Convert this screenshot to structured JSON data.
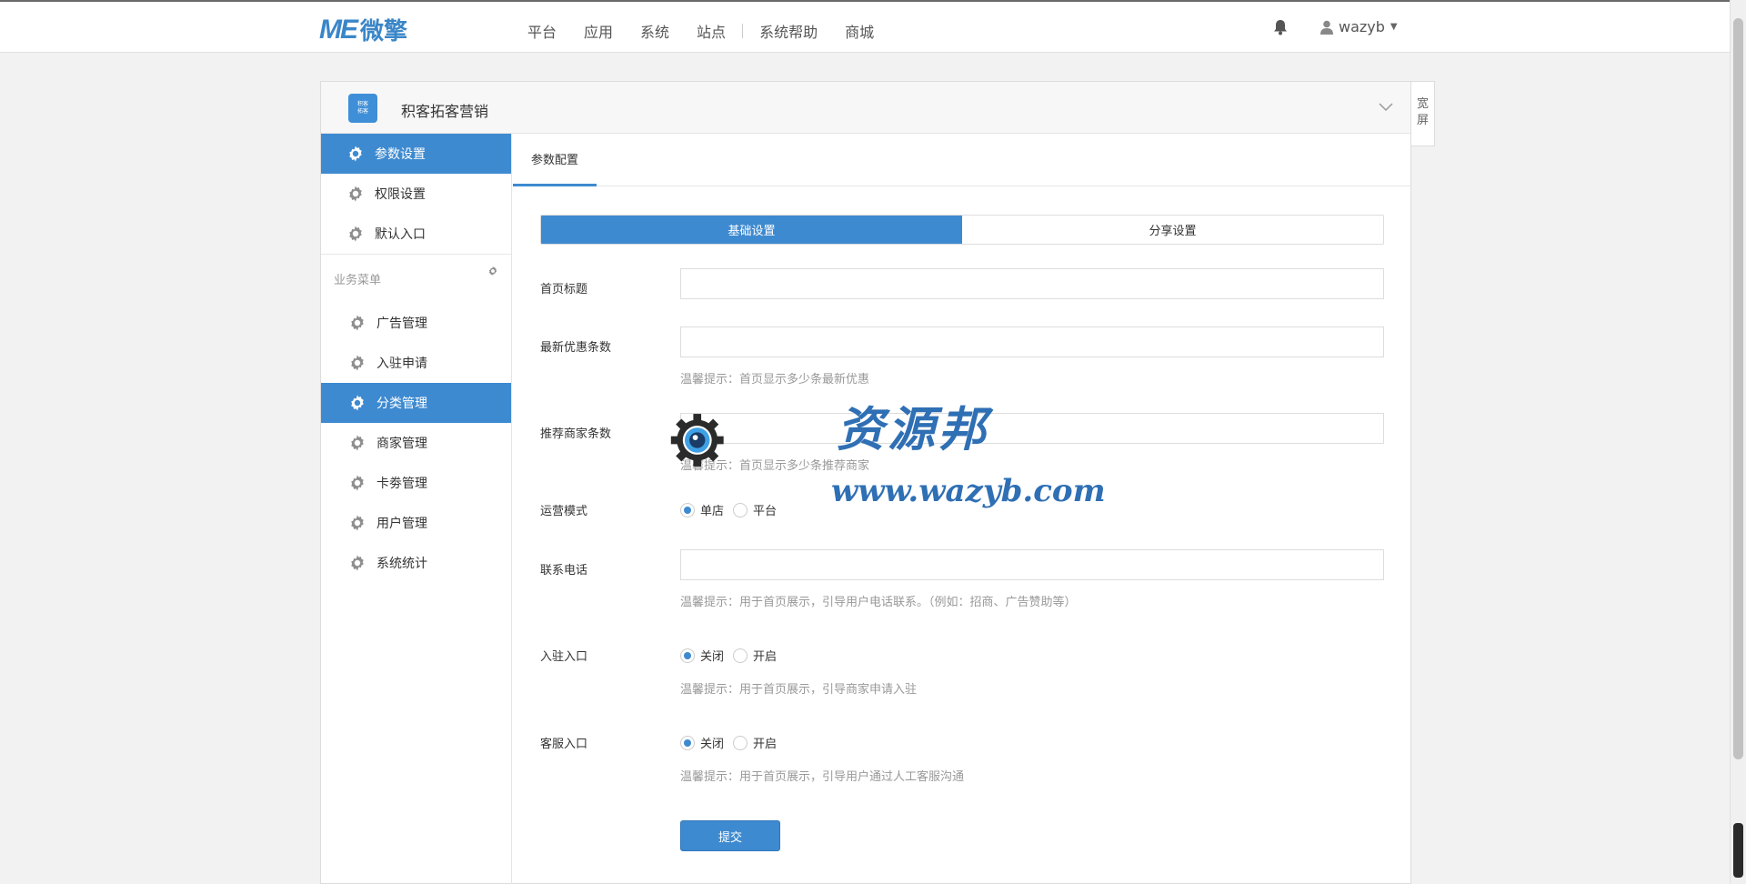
{
  "topbar": {
    "logo_mark": "ME",
    "logo_text": "微擎",
    "nav": [
      "平台",
      "应用",
      "系统",
      "站点",
      "系统帮助",
      "商城"
    ],
    "username": "wazyb"
  },
  "module": {
    "icon_text_1": "积客",
    "icon_text_2": "拓客",
    "title": "积客拓客营销",
    "wide_label_1": "宽",
    "wide_label_2": "屏"
  },
  "sidebar": {
    "top_items": [
      {
        "label": "参数设置",
        "active": true
      },
      {
        "label": "权限设置",
        "active": false
      },
      {
        "label": "默认入口",
        "active": false
      }
    ],
    "group_title": "业务菜单",
    "group_items": [
      {
        "label": "广告管理",
        "active": false
      },
      {
        "label": "入驻申请",
        "active": false
      },
      {
        "label": "分类管理",
        "active": true
      },
      {
        "label": "商家管理",
        "active": false
      },
      {
        "label": "卡劵管理",
        "active": false
      },
      {
        "label": "用户管理",
        "active": false
      },
      {
        "label": "系统统计",
        "active": false
      }
    ]
  },
  "content": {
    "tab": "参数配置",
    "segments": [
      "基础设置",
      "分享设置"
    ],
    "fields": {
      "home_title": {
        "label": "首页标题",
        "value": ""
      },
      "latest_count": {
        "label": "最新优惠条数",
        "value": "",
        "hint": "温馨提示：首页显示多少条最新优惠"
      },
      "recommend_count": {
        "label": "推荐商家条数",
        "value": "",
        "hint": "温馨提示：首页显示多少条推荐商家"
      },
      "mode": {
        "label": "运营模式",
        "options": [
          "单店",
          "平台"
        ],
        "selected": "单店"
      },
      "phone": {
        "label": "联系电话",
        "value": "",
        "hint": "温馨提示：用于首页展示，引导用户电话联系。（例如：招商、广告赞助等）"
      },
      "join_entry": {
        "label": "入驻入口",
        "options": [
          "关闭",
          "开启"
        ],
        "selected": "关闭",
        "hint": "温馨提示：用于首页展示，引导商家申请入驻"
      },
      "service_entry": {
        "label": "客服入口",
        "options": [
          "关闭",
          "开启"
        ],
        "selected": "关闭",
        "hint": "温馨提示：用于首页展示，引导用户通过人工客服沟通"
      }
    },
    "submit": "提交"
  },
  "watermark": {
    "text": "资源邦",
    "url": "www.wazyb.com"
  },
  "colors": {
    "primary": "#3e8ad0",
    "logo": "#3a86c8",
    "page_bg": "#f2f2f2"
  }
}
